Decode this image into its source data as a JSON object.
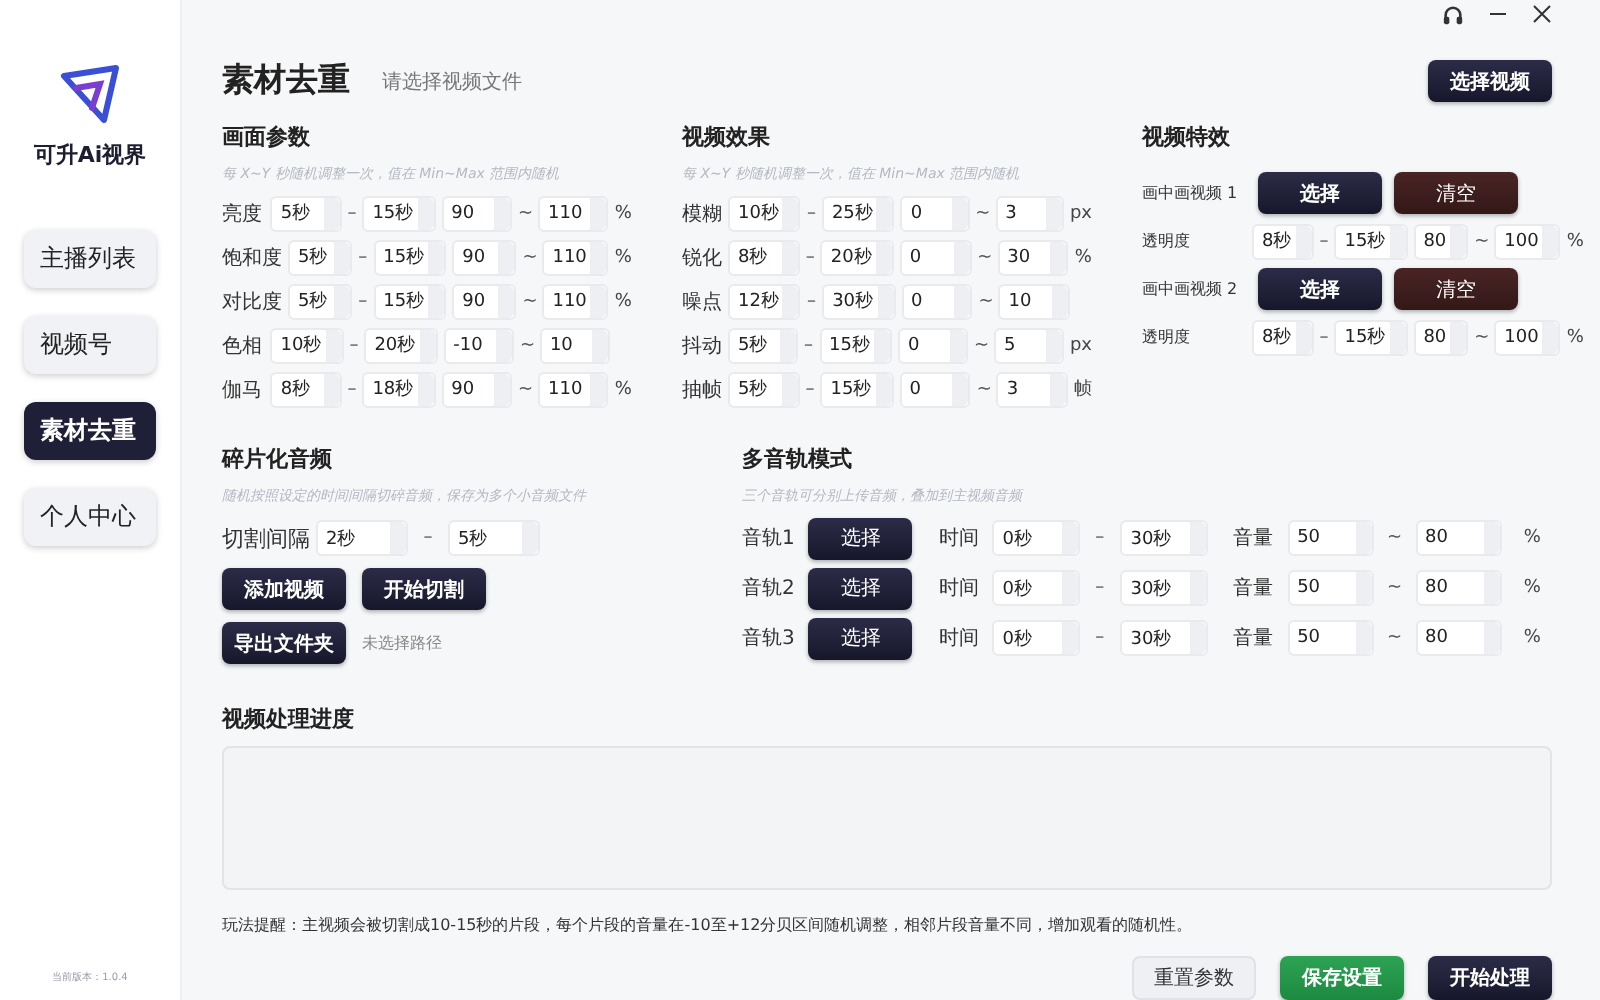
{
  "app": {
    "name": "可升Ai视界",
    "version": "当前版本：1.0.4"
  },
  "nav": [
    {
      "label": "主播列表",
      "selected": false
    },
    {
      "label": "视频号",
      "selected": false
    },
    {
      "label": "素材去重",
      "selected": true
    },
    {
      "label": "个人中心",
      "selected": false
    }
  ],
  "header": {
    "title": "素材去重",
    "subtitle": "请选择视频文件",
    "button": "选择视频"
  },
  "picture_params": {
    "title": "画面参数",
    "hint": "每 X~Y 秒随机调整一次，值在 Min~Max 范围内随机",
    "rows": [
      {
        "label": "亮度",
        "from": "5秒",
        "sep1": "–",
        "to": "15秒",
        "min": "90",
        "sep2": "~",
        "max": "110",
        "unit": "%"
      },
      {
        "label": "饱和度",
        "from": "5秒",
        "sep1": "–",
        "to": "15秒",
        "min": "90",
        "sep2": "~",
        "max": "110",
        "unit": "%"
      },
      {
        "label": "对比度",
        "from": "5秒",
        "sep1": "–",
        "to": "15秒",
        "min": "90",
        "sep2": "~",
        "max": "110",
        "unit": "%"
      },
      {
        "label": "色相",
        "from": "10秒",
        "sep1": "–",
        "to": "20秒",
        "min": "-10",
        "sep2": "~",
        "max": "10"
      },
      {
        "label": "伽马",
        "from": "8秒",
        "sep1": "–",
        "to": "18秒",
        "min": "90",
        "sep2": "~",
        "max": "110",
        "unit": "%"
      }
    ]
  },
  "video_effects": {
    "title": "视频效果",
    "hint": "每 X~Y 秒随机调整一次，值在 Min~Max 范围内随机",
    "rows": [
      {
        "label": "模糊",
        "from": "10秒",
        "sep1": "–",
        "to": "25秒",
        "min": "0",
        "sep2": "~",
        "max": "3",
        "unit": "px"
      },
      {
        "label": "锐化",
        "from": "8秒",
        "sep1": "–",
        "to": "20秒",
        "min": "0",
        "sep2": "~",
        "max": "30",
        "unit": "%"
      },
      {
        "label": "噪点",
        "from": "12秒",
        "sep1": "–",
        "to": "30秒",
        "min": "0",
        "sep2": "~",
        "max": "10"
      },
      {
        "label": "抖动",
        "from": "5秒",
        "sep1": "–",
        "to": "15秒",
        "min": "0",
        "sep2": "~",
        "max": "5",
        "unit": "px"
      },
      {
        "label": "抽帧",
        "from": "5秒",
        "sep1": "–",
        "to": "15秒",
        "min": "0",
        "sep2": "~",
        "max": "3",
        "unit": "帧"
      }
    ]
  },
  "video_overlay": {
    "title": "视频特效",
    "rows": [
      {
        "kind": "video",
        "label": "画中画视频 1",
        "select": "选择",
        "clear": "清空"
      },
      {
        "kind": "range",
        "label": "透明度",
        "from": "8秒",
        "sep1": "–",
        "to": "15秒",
        "min": "80",
        "sep2": "~",
        "max": "100",
        "unit": "%"
      },
      {
        "kind": "video",
        "label": "画中画视频 2",
        "select": "选择",
        "clear": "清空"
      },
      {
        "kind": "range",
        "label": "透明度",
        "from": "8秒",
        "sep1": "–",
        "to": "15秒",
        "min": "80",
        "sep2": "~",
        "max": "100",
        "unit": "%"
      }
    ]
  },
  "audio_split": {
    "title": "碎片化音频",
    "hint": "随机按照设定的时间间隔切碎音频，保存为多个小音频文件",
    "interval": {
      "label": "切割间隔",
      "from": "2秒",
      "sep": "–",
      "to": "5秒"
    },
    "buttons": [
      "添加视频",
      "开始切割"
    ],
    "export": {
      "button": "导出文件夹",
      "path": "未选择路径"
    }
  },
  "multitrack": {
    "title": "多音轨模式",
    "hint": "三个音轨可分别上传音频，叠加到主视频音频",
    "tracks": [
      {
        "label": "音轨1",
        "button": "选择",
        "time_label": "时间",
        "from": "0秒",
        "sep1": "–",
        "to": "30秒",
        "volume_label": "音量",
        "vmin": "50",
        "sep2": "~",
        "vmax": "80",
        "unit": "%"
      },
      {
        "label": "音轨2",
        "button": "选择",
        "time_label": "时间",
        "from": "0秒",
        "sep1": "–",
        "to": "30秒",
        "volume_label": "音量",
        "vmin": "50",
        "sep2": "~",
        "vmax": "80",
        "unit": "%"
      },
      {
        "label": "音轨3",
        "button": "选择",
        "time_label": "时间",
        "from": "0秒",
        "sep1": "–",
        "to": "30秒",
        "volume_label": "音量",
        "vmin": "50",
        "sep2": "~",
        "vmax": "80",
        "unit": "%"
      }
    ]
  },
  "progress": {
    "title": "视频处理进度"
  },
  "tip": "玩法提醒：主视频会被切割成10-15秒的片段，每个片段的音量在-10至+12分贝区间随机调整，相邻片段音量不同，增加观看的随机性。",
  "actions": [
    {
      "label": "重置参数",
      "kind": "light"
    },
    {
      "label": "保存设置",
      "kind": "green"
    },
    {
      "label": "开始处理",
      "kind": "dark"
    }
  ]
}
